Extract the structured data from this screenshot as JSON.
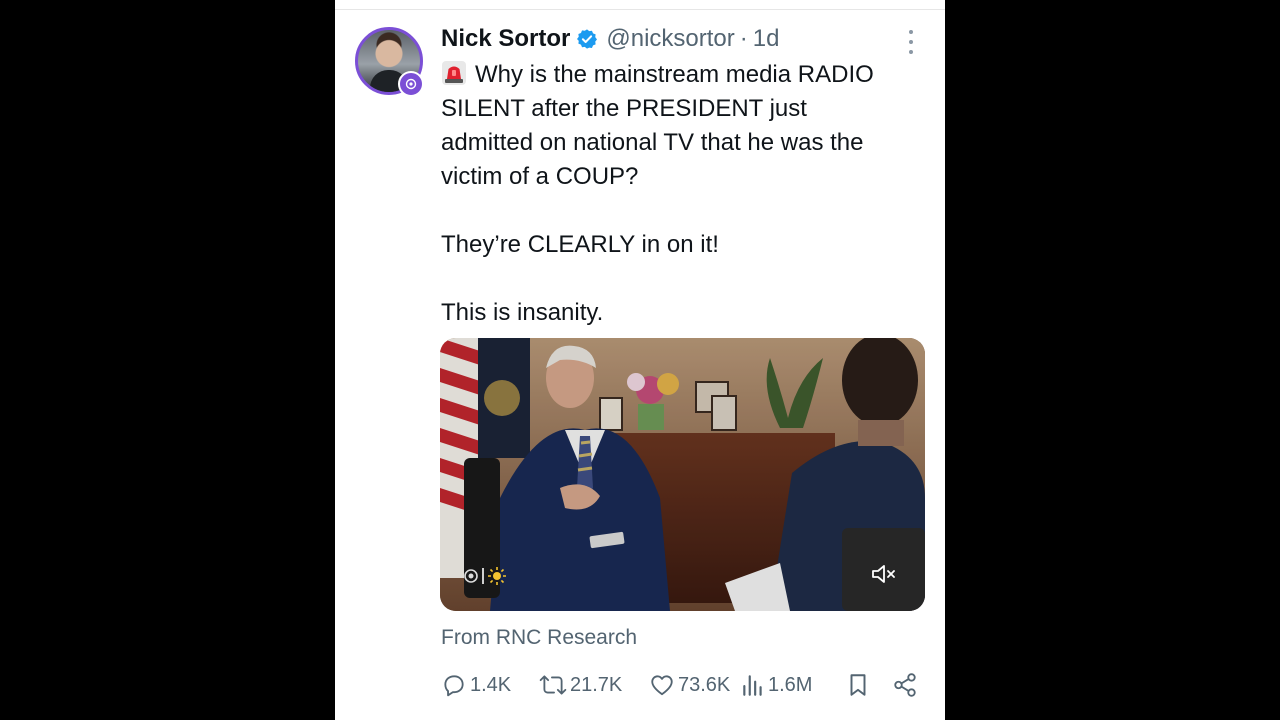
{
  "tweet": {
    "author_name": "Nick Sortor",
    "handle": "@nicksortor",
    "separator": "·",
    "time": "1d",
    "verified": true,
    "body": {
      "line1": "Why is the mainstream media RADIO",
      "line2": "SILENT after the PRESIDENT just",
      "line3": "admitted on national TV that he was the",
      "line4": "victim of a COUP?",
      "line5": "They’re CLEARLY in on it!",
      "line6": "This is insanity."
    },
    "media": {
      "type": "video",
      "muted": true
    },
    "attribution": "From RNC Research"
  },
  "actions": {
    "replies": "1.4K",
    "reposts": "21.7K",
    "likes": "73.6K",
    "views": "1.6M"
  },
  "icons": {
    "verified": "verified-badge-icon",
    "emoji": "police-siren-icon",
    "more": "more-vertical-icon",
    "mute": "volume-mute-icon",
    "reply": "reply-icon",
    "repost": "repost-icon",
    "like": "heart-icon",
    "views": "bar-chart-icon",
    "bookmark": "bookmark-icon",
    "share": "share-icon"
  },
  "colors": {
    "accent": "#1d9bf0",
    "text_primary": "#0f1419",
    "text_secondary": "#536471",
    "avatar_ring": "#7b4fd6",
    "background": "#ffffff",
    "letterbox": "#000000"
  }
}
